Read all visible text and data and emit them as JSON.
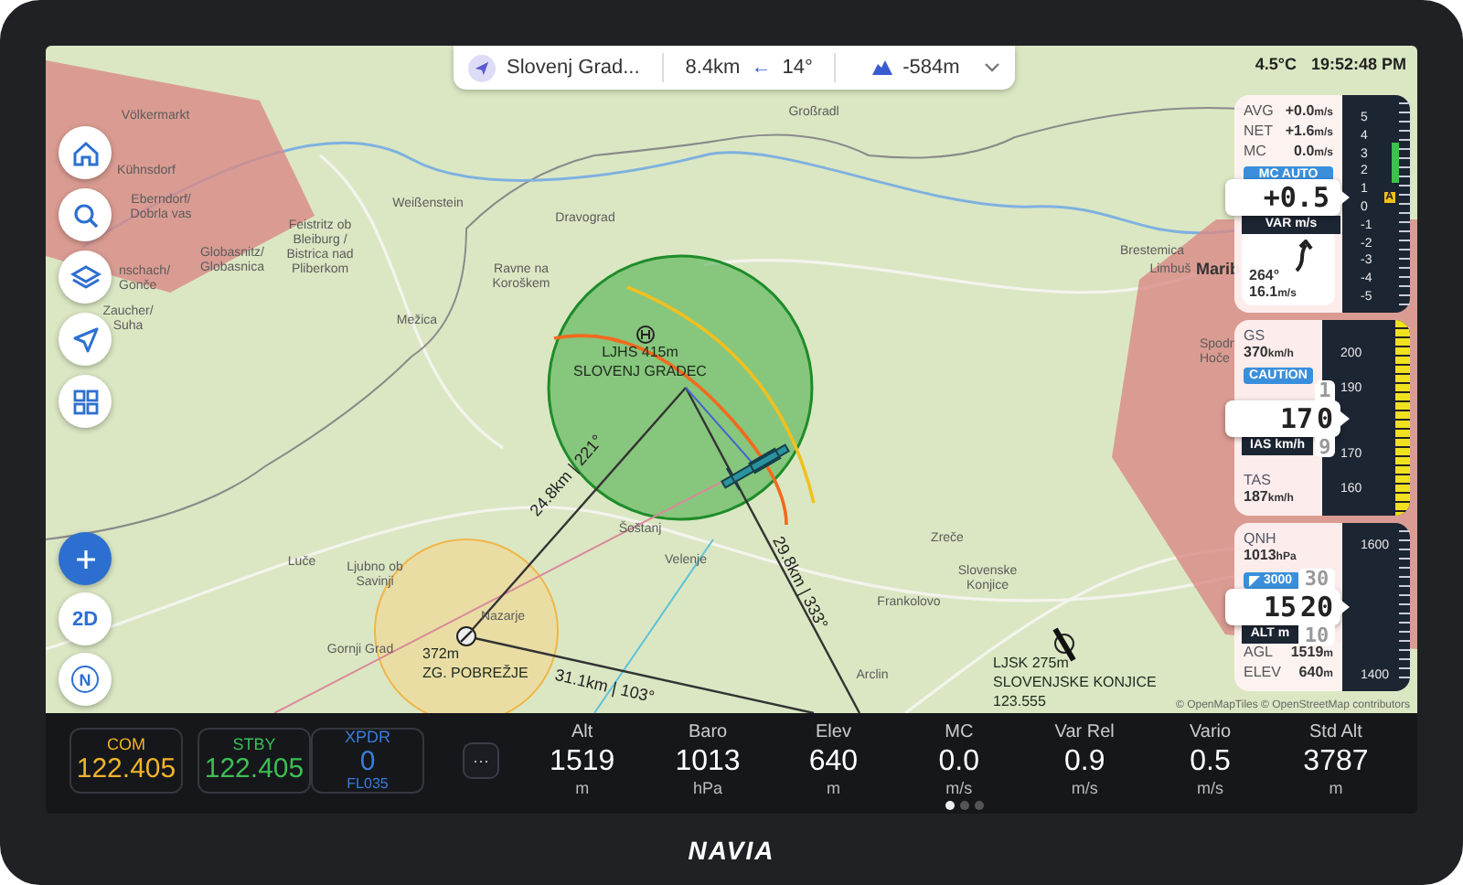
{
  "status": {
    "temperature": "4.5°C",
    "time": "19:52:48 PM"
  },
  "nav_bar": {
    "target": "Slovenj Grad...",
    "distance": "8.4km",
    "arrow": "←",
    "bearing": "14°",
    "altitude_diff": "-584m"
  },
  "map_controls": [
    {
      "kind": "home"
    },
    {
      "kind": "search"
    },
    {
      "kind": "layers"
    },
    {
      "kind": "navigate"
    },
    {
      "kind": "apps"
    },
    {
      "kind": "zoom"
    },
    {
      "kind": "view",
      "label": "2D"
    },
    {
      "kind": "compass",
      "label": "N"
    }
  ],
  "map": {
    "towns": [
      {
        "lines": [
          "Völkermarkt"
        ]
      },
      {
        "lines": [
          "Kühnsdorf"
        ]
      },
      {
        "lines": [
          "Eberndorf/",
          "Dobrla vas"
        ]
      },
      {
        "lines": [
          "nschach/",
          "Gonče"
        ]
      },
      {
        "lines": [
          "Zaucher/",
          "Suha"
        ]
      },
      {
        "lines": [
          "Globasnitz/",
          "Globasnica"
        ]
      },
      {
        "lines": [
          "Feistritz ob",
          "Bleiburg /",
          "Bistrica nad",
          "Pliberkom"
        ]
      },
      {
        "lines": [
          "Weißenstein"
        ]
      },
      {
        "lines": [
          "Dravograd"
        ]
      },
      {
        "lines": [
          "Ravne na",
          "Koroškem"
        ]
      },
      {
        "lines": [
          "Mežica"
        ]
      },
      {
        "lines": [
          "Luče"
        ]
      },
      {
        "lines": [
          "Ljubno ob",
          "Savinji"
        ]
      },
      {
        "lines": [
          "Nazarje"
        ]
      },
      {
        "lines": [
          "Gornji Grad"
        ]
      },
      {
        "lines": [
          "Šoštanj"
        ]
      },
      {
        "lines": [
          "Velenje"
        ]
      },
      {
        "lines": [
          "Großradl"
        ]
      },
      {
        "lines": [
          "Brestemica"
        ]
      },
      {
        "lines": [
          "Limbuš"
        ]
      },
      {
        "lines": [
          "Marib"
        ]
      },
      {
        "lines": [
          "Spodn",
          "Hoče"
        ]
      },
      {
        "lines": [
          "Zreče"
        ]
      },
      {
        "lines": [
          "Slovenske",
          "Konjice"
        ]
      },
      {
        "lines": [
          "Frankolovo"
        ]
      },
      {
        "lines": [
          "Arclin"
        ]
      }
    ],
    "airfields": [
      {
        "lines": [
          "LJHS 415m",
          "SLOVENJ GRADEC"
        ]
      },
      {
        "lines": [
          "372m",
          "ZG. POBREŽJE"
        ]
      },
      {
        "lines": [
          "LJSK 275m",
          "SLOVENJSKE KONJICE",
          "123.555"
        ]
      }
    ],
    "routes": [
      {
        "label": "24.8km | 221°"
      },
      {
        "label": "29.8km | 333°"
      },
      {
        "label": "31.1km | 103°"
      }
    ],
    "attribution": "© OpenMapTiles © OpenStreetMap contributors"
  },
  "vario": {
    "rows": [
      {
        "label": "AVG",
        "value": "+0.0",
        "unit": "m/s"
      },
      {
        "label": "NET",
        "value": "+1.6",
        "unit": "m/s"
      },
      {
        "label": "MC",
        "value": "0.0",
        "unit": "m/s"
      }
    ],
    "mode": "MC AUTO",
    "reading": "+0.5",
    "caption": "VAR m/s",
    "scale": [
      "5",
      "4",
      "3",
      "2",
      "1",
      "0",
      "-1",
      "-2",
      "-3",
      "-4",
      "-5"
    ],
    "marker": "A",
    "wind": {
      "direction": "264°",
      "speed": "16.1",
      "unit": "m/s"
    }
  },
  "airspeed": {
    "rows": [
      {
        "label": "GS",
        "value": "370",
        "unit": "km/h"
      }
    ],
    "alert": "CAUTION",
    "reading": "17",
    "roller": {
      "above": "1",
      "current": "0",
      "below": "9"
    },
    "caption": "IAS km/h",
    "scale": [
      "200",
      "190",
      "170",
      "160"
    ],
    "bottom_rows": [
      {
        "label": "TAS",
        "value": "187",
        "unit": "km/h"
      }
    ]
  },
  "altimeter": {
    "rows": [
      {
        "label": "QNH",
        "value": "1013",
        "unit": "hPa"
      }
    ],
    "target": "3000",
    "reading": "15",
    "roller": {
      "above": "30",
      "current": "20",
      "below": "10"
    },
    "caption": "ALT m",
    "scale": [
      "1600",
      "1400"
    ],
    "bottom_rows": [
      {
        "label": "AGL",
        "value": "1519",
        "unit": "m"
      },
      {
        "label": "ELEV",
        "value": "640",
        "unit": "m"
      }
    ]
  },
  "radios": [
    {
      "label": "COM",
      "value": "122.405",
      "color": "#f0b429"
    },
    {
      "label": "STBY",
      "value": "122.405",
      "color": "#3cbf55"
    },
    {
      "label": "XPDR",
      "value": "0",
      "sub": "FL035",
      "color": "#3b7ddd"
    }
  ],
  "more_button": "···",
  "stats": [
    {
      "label": "Alt",
      "value": "1519",
      "unit": "m"
    },
    {
      "label": "Baro",
      "value": "1013",
      "unit": "hPa"
    },
    {
      "label": "Elev",
      "value": "640",
      "unit": "m"
    },
    {
      "label": "MC",
      "value": "0.0",
      "unit": "m/s"
    },
    {
      "label": "Var Rel",
      "value": "0.9",
      "unit": "m/s"
    },
    {
      "label": "Vario",
      "value": "0.5",
      "unit": "m/s"
    },
    {
      "label": "Std Alt",
      "value": "3787",
      "unit": "m"
    }
  ],
  "pager": [
    {
      "selected": true
    },
    {
      "selected": false
    },
    {
      "selected": false
    }
  ],
  "brand": "NAVIA"
}
